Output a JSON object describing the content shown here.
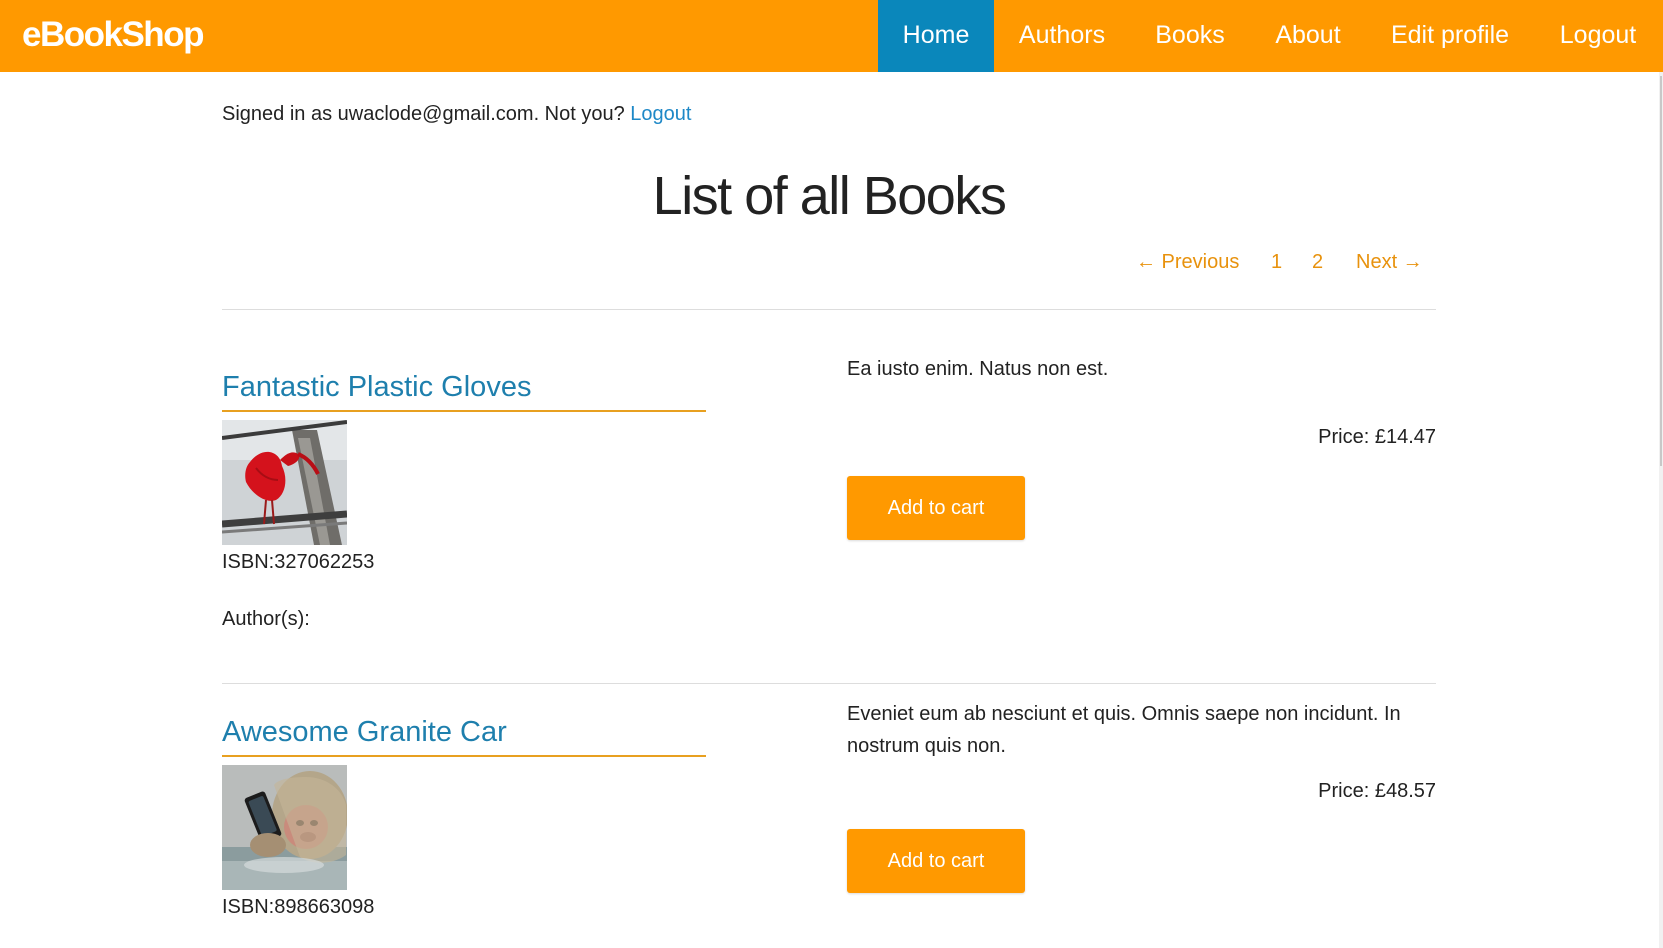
{
  "nav": {
    "brand": "eBookShop",
    "items": [
      {
        "label": "Home"
      },
      {
        "label": "Authors"
      },
      {
        "label": "Books"
      },
      {
        "label": "About"
      },
      {
        "label": "Edit profile"
      },
      {
        "label": "Logout"
      }
    ],
    "active_item": "Home",
    "colors": {
      "bar": "#ff9900",
      "active": "#0a87bb"
    }
  },
  "session": {
    "prefix": "Signed in as uwaclode@gmail.com. Not you?",
    "logout_link": "Logout"
  },
  "page": {
    "title": "List of all Books"
  },
  "pagination": {
    "previous": "← Previous",
    "pages": [
      "1",
      "2"
    ],
    "next": "Next →"
  },
  "books": [
    {
      "title": "Fantastic Plastic Gloves",
      "image": "red-bird-photo",
      "isbn": "ISBN:327062253",
      "authors_label": "Author(s):",
      "description": "Ea iusto enim. Natus non est.",
      "price": "Price: £14.47",
      "button": "Add to cart"
    },
    {
      "title": "Awesome Granite Car",
      "image": "monkey-with-phone-photo",
      "isbn": "ISBN:898663098",
      "description": "Eveniet eum ab nesciunt et quis. Omnis saepe non incidunt. In nostrum quis non.",
      "price": "Price: £48.57",
      "button": "Add to cart"
    }
  ],
  "theme": {
    "accent": "#ff9900",
    "link": "#1e88c7",
    "pager_link": "#e8920d"
  }
}
